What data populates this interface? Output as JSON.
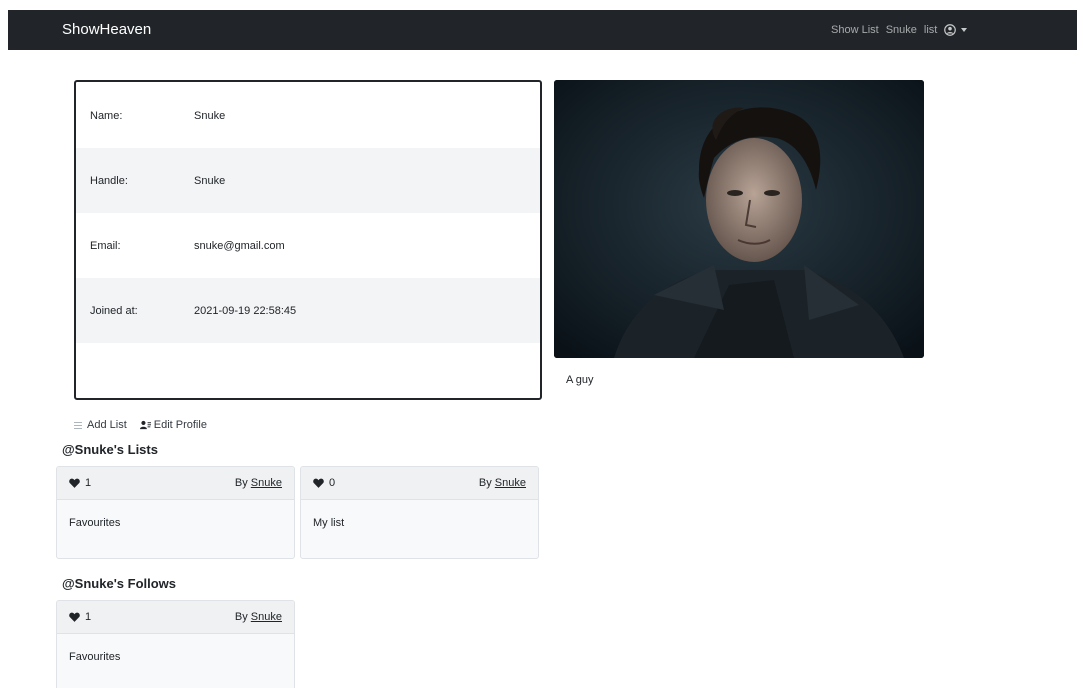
{
  "navbar": {
    "brand": "ShowHeaven",
    "links": [
      "Show List",
      "Snuke",
      "list"
    ],
    "user_icon": "user-circle-icon"
  },
  "profile": {
    "fields": [
      {
        "label": "Name:",
        "value": "Snuke"
      },
      {
        "label": "Handle:",
        "value": "Snuke"
      },
      {
        "label": "Email:",
        "value": "snuke@gmail.com"
      },
      {
        "label": "Joined at:",
        "value": "2021-09-19 22:58:45"
      }
    ],
    "caption": "A guy"
  },
  "actions": {
    "add_list": "Add List",
    "edit_profile": "Edit Profile"
  },
  "lists_section": {
    "title": "@Snuke's Lists",
    "cards": [
      {
        "likes": "1",
        "by_prefix": "By",
        "by_user": "Snuke",
        "name": "Favourites"
      },
      {
        "likes": "0",
        "by_prefix": "By",
        "by_user": "Snuke",
        "name": "My list"
      }
    ]
  },
  "follows_section": {
    "title": "@Snuke's Follows",
    "cards": [
      {
        "likes": "1",
        "by_prefix": "By",
        "by_user": "Snuke",
        "name": "Favourites"
      }
    ]
  },
  "colors": {
    "navbar": "#212529",
    "accent": "#212529",
    "row_shade": "#f3f4f6"
  }
}
